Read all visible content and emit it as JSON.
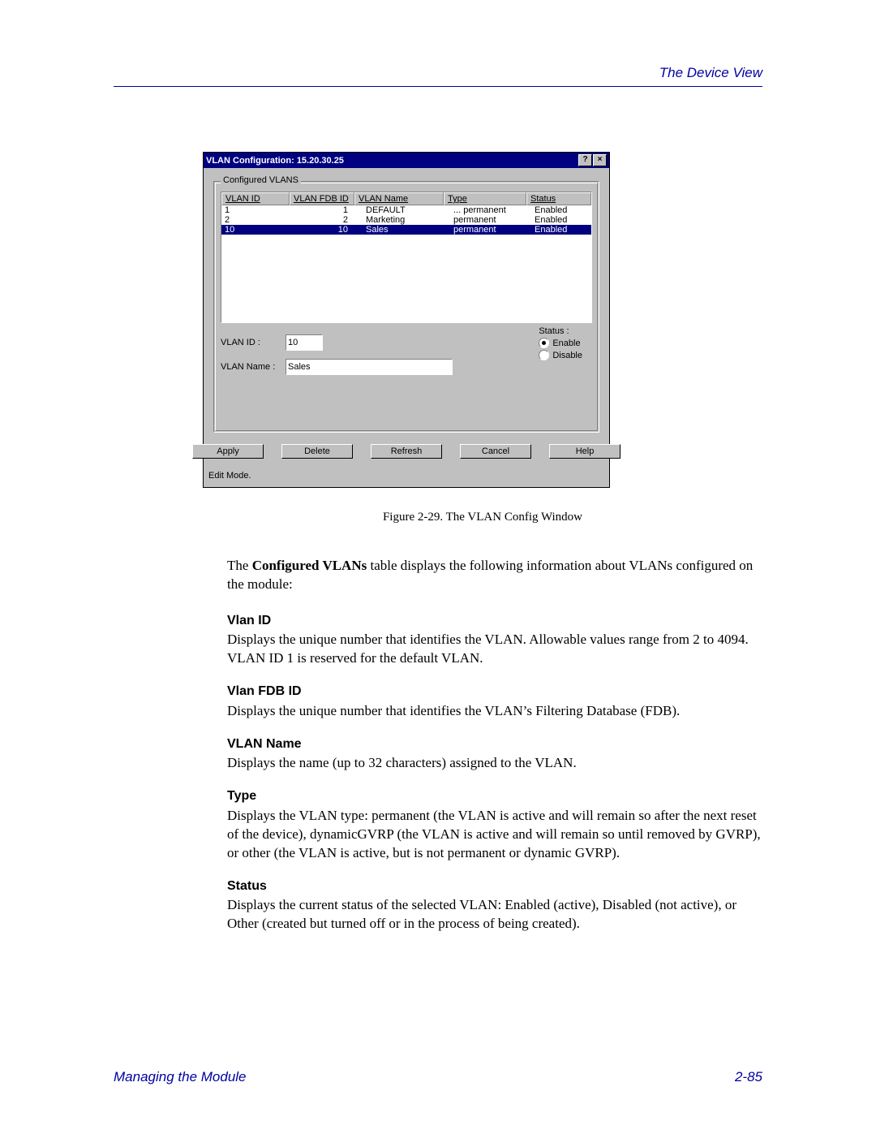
{
  "header": {
    "section_title": "The Device View"
  },
  "dialog": {
    "title": "VLAN Configuration: 15.20.30.25",
    "help_btn": "?",
    "close_btn": "×",
    "groupbox_title": "Configured VLANS",
    "columns": {
      "c1": "VLAN ID",
      "c2": "VLAN FDB ID",
      "c3": "VLAN Name",
      "c4": "Type",
      "c5": "Status"
    },
    "rows": [
      {
        "id": "1",
        "fdb": "1",
        "name": "DEFAULT",
        "type": "... permanent",
        "status": "Enabled",
        "selected": false
      },
      {
        "id": "2",
        "fdb": "2",
        "name": "Marketing",
        "type": "permanent",
        "status": "Enabled",
        "selected": false
      },
      {
        "id": "10",
        "fdb": "10",
        "name": "Sales",
        "type": "permanent",
        "status": "Enabled",
        "selected": true
      }
    ],
    "form": {
      "vlan_id_label": "VLAN ID :",
      "vlan_id_value": "10",
      "vlan_name_label": "VLAN Name :",
      "vlan_name_value": "Sales",
      "status_label": "Status :",
      "enable_label": "Enable",
      "disable_label": "Disable",
      "enable_selected": true
    },
    "buttons": {
      "apply": "Apply",
      "delete": "Delete",
      "refresh": "Refresh",
      "cancel": "Cancel",
      "help": "Help"
    },
    "edit_mode": "Edit Mode."
  },
  "caption": "Figure 2-29.  The VLAN Config Window",
  "intro_pre": "The ",
  "intro_bold": "Configured VLANs",
  "intro_post": " table displays the following information about VLANs configured on the module:",
  "defs": {
    "d1t": "Vlan ID",
    "d1": "Displays the unique number that identifies the VLAN. Allowable values range from 2 to 4094. VLAN ID 1 is reserved for the default VLAN.",
    "d2t": "Vlan FDB ID",
    "d2": "Displays the unique number that identifies the VLAN’s Filtering Database (FDB).",
    "d3t": "VLAN Name",
    "d3": "Displays the name (up to 32 characters) assigned to the VLAN.",
    "d4t": "Type",
    "d4": "Displays the VLAN type: permanent (the VLAN is active and will remain so after the next reset of the device), dynamicGVRP (the VLAN is active and will remain so until removed by GVRP), or other (the VLAN is active, but is not permanent or dynamic GVRP).",
    "d5t": "Status",
    "d5": "Displays the current status of the selected VLAN: Enabled (active), Disabled (not active), or Other (created but turned off or in the process of being created)."
  },
  "footer": {
    "left": "Managing the Module",
    "right": "2-85"
  }
}
